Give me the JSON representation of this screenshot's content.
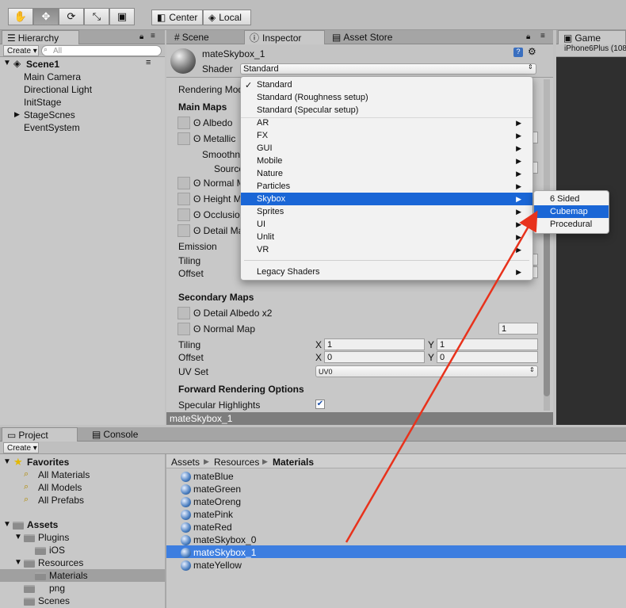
{
  "toolbar": {
    "tools": [
      "hand-icon",
      "move-icon",
      "rotate-icon",
      "scale-icon",
      "rect-tool-icon"
    ],
    "center_label": "Center",
    "local_label": "Local"
  },
  "hierarchy": {
    "tab": "Hierarchy",
    "create_label": "Create ▾",
    "search_placeholder": "All",
    "scene": "Scene1",
    "items": [
      "Main Camera",
      "Directional Light",
      "InitStage",
      "StageScnes",
      "EventSystem"
    ]
  },
  "center_tabs": {
    "scene": "Scene",
    "inspector": "Inspector",
    "asset_store": "Asset Store"
  },
  "game": {
    "tab": "Game",
    "resolution": "iPhone6Plus (108"
  },
  "inspector": {
    "material_name": "mateSkybox_1",
    "shader_label": "Shader",
    "shader_value": "Standard",
    "rendering_mode": "Rendering Mod",
    "main_maps": "Main Maps",
    "albedo": "Albedo",
    "metallic": "Metallic",
    "smoothness": "Smoothn",
    "source": "Source",
    "normal_map_short": "Normal M",
    "height_map_short": "Height M",
    "occlusion_short": "Occlusio",
    "detail_mask_short": "Detail Ma",
    "emission": "Emission",
    "tiling": "Tiling",
    "offset": "Offset",
    "secondary_maps": "Secondary Maps",
    "detail_albedo": "Detail Albedo x2",
    "normal_map": "Normal Map",
    "normal_map_value": "1",
    "tiling2": "Tiling",
    "offset2": "Offset",
    "tiling_x": "1",
    "tiling_y": "1",
    "offset_x": "0",
    "offset_y": "0",
    "x_label": "X",
    "y_label": "Y",
    "uv_set": "UV Set",
    "uv_set_value": "UV0",
    "forward_options": "Forward Rendering Options",
    "specular_highlights": "Specular Highlights",
    "footer_name": "mateSkybox_1"
  },
  "shader_menu": {
    "items": [
      {
        "label": "Standard",
        "checked": true,
        "submenu": false
      },
      {
        "label": "Standard (Roughness setup)",
        "submenu": false
      },
      {
        "label": "Standard (Specular setup)",
        "submenu": false
      },
      {
        "label": "AR",
        "submenu": true
      },
      {
        "label": "FX",
        "submenu": true
      },
      {
        "label": "GUI",
        "submenu": true
      },
      {
        "label": "Mobile",
        "submenu": true
      },
      {
        "label": "Nature",
        "submenu": true
      },
      {
        "label": "Particles",
        "submenu": true
      },
      {
        "label": "Skybox",
        "submenu": true,
        "selected": true
      },
      {
        "label": "Sprites",
        "submenu": true
      },
      {
        "label": "UI",
        "submenu": true
      },
      {
        "label": "Unlit",
        "submenu": true
      },
      {
        "label": "VR",
        "submenu": true
      }
    ],
    "legacy": "Legacy Shaders",
    "skybox_submenu": [
      "6 Sided",
      "Cubemap",
      "Procedural"
    ],
    "selected_sub": "Cubemap"
  },
  "project": {
    "tab": "Project",
    "console_tab": "Console",
    "create_label": "Create ▾",
    "favorites": "Favorites",
    "favorite_items": [
      "All Materials",
      "All Models",
      "All Prefabs"
    ],
    "assets": "Assets",
    "plugins": "Plugins",
    "ios": "iOS",
    "resources": "Resources",
    "materials": "Materials",
    "png": "png",
    "scenes": "Scenes",
    "breadcrumb": [
      "Assets",
      "Resources",
      "Materials"
    ],
    "files": [
      "mateBlue",
      "mateGreen",
      "mateOreng",
      "matePink",
      "mateRed",
      "mateSkybox_0",
      "mateSkybox_1",
      "mateYellow"
    ],
    "selected_file": "mateSkybox_1"
  },
  "colors": {
    "selection": "#1a66d6",
    "arrow": "#e8321c"
  }
}
